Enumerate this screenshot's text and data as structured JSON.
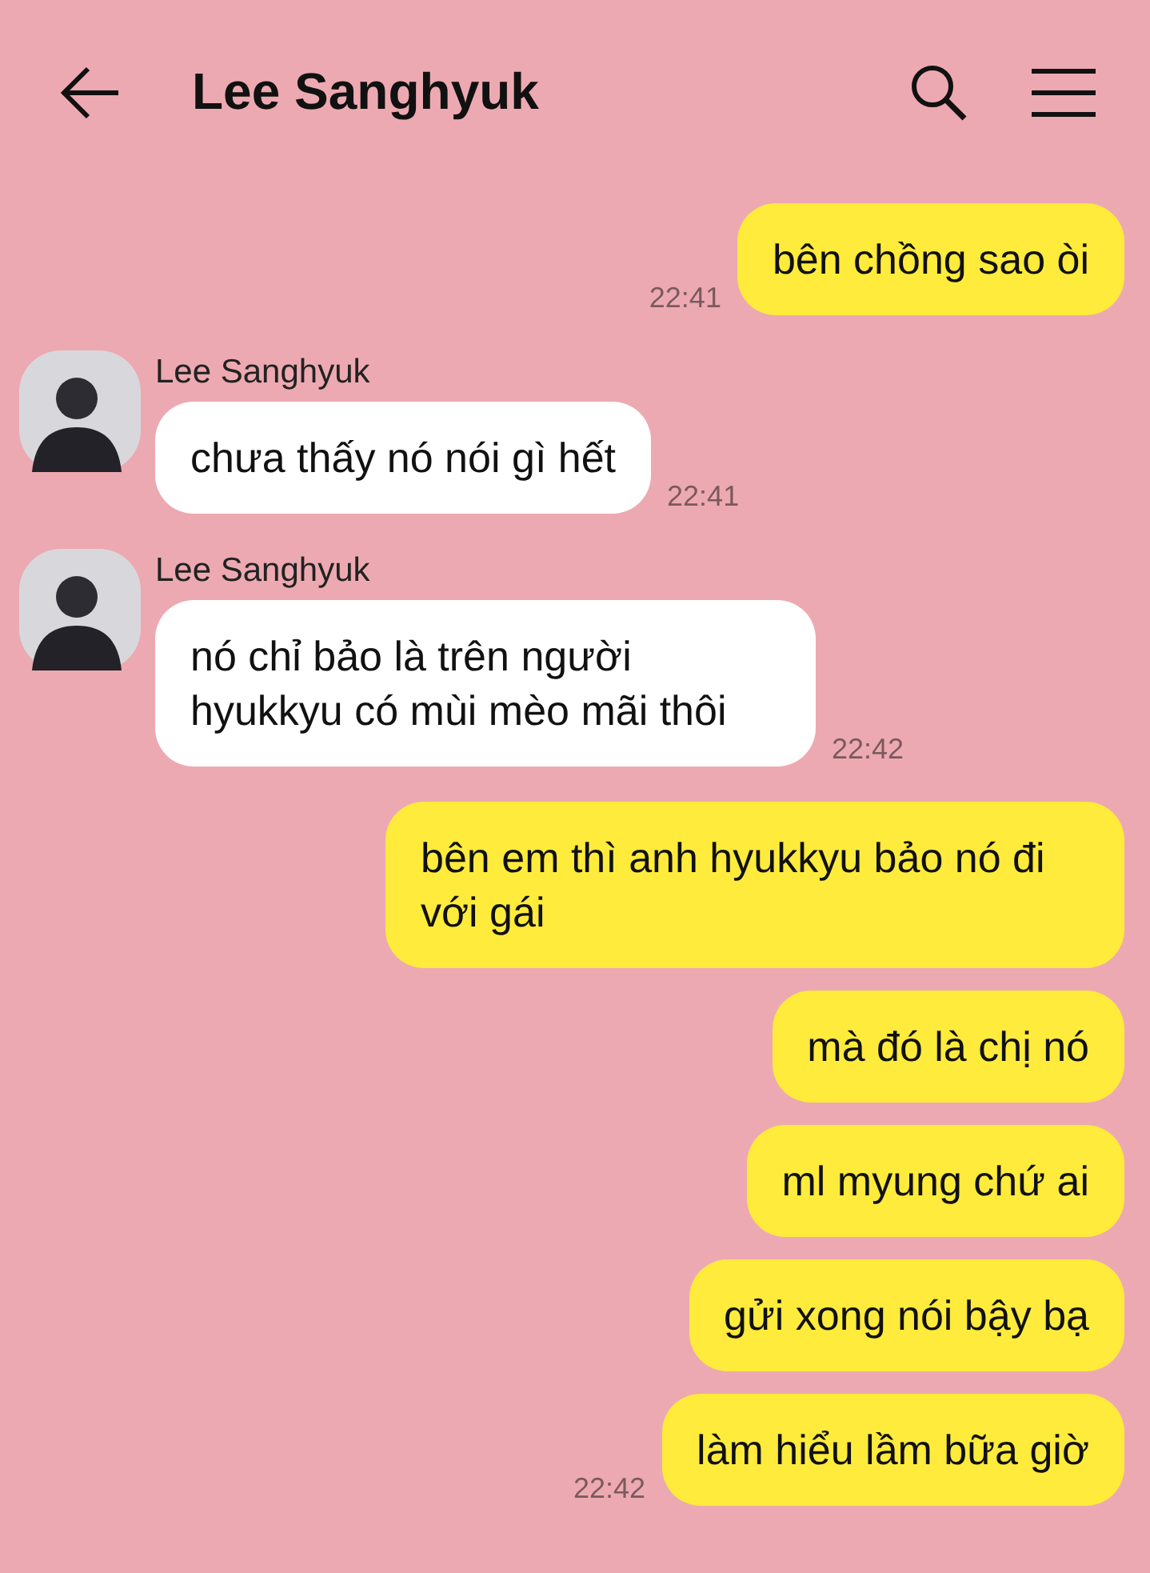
{
  "header": {
    "title": "Lee Sanghyuk"
  },
  "messages": [
    {
      "kind": "outgoing",
      "text": "bên chồng sao òi",
      "time": "22:41"
    },
    {
      "kind": "incoming",
      "sender": "Lee Sanghyuk",
      "text": "chưa thấy nó nói gì hết",
      "time": "22:41"
    },
    {
      "kind": "incoming",
      "sender": "Lee Sanghyuk",
      "text": "nó chỉ bảo là trên người hyukkyu có mùi mèo mãi thôi",
      "time": "22:42"
    },
    {
      "kind": "outgoing",
      "text": "bên em thì anh hyukkyu bảo nó đi với gái"
    },
    {
      "kind": "outgoing",
      "text": "mà đó là chị nó"
    },
    {
      "kind": "outgoing",
      "text": "ml myung chứ ai"
    },
    {
      "kind": "outgoing",
      "text": "gửi xong nói bậy bạ"
    },
    {
      "kind": "outgoing",
      "text": "làm hiểu lầm bữa giờ",
      "time": "22:42"
    }
  ]
}
